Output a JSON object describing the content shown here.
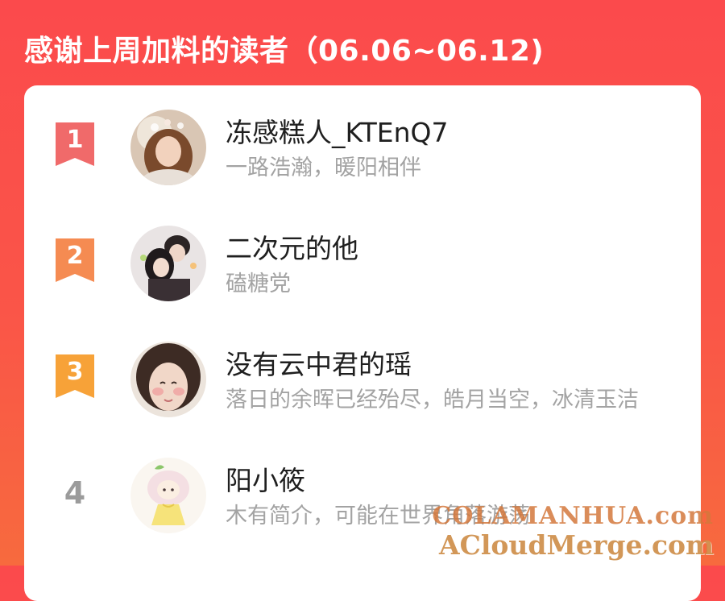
{
  "header": {
    "title": "感谢上周加料的读者（06.06~06.12)"
  },
  "readers": [
    {
      "rank": "1",
      "name": "冻感糕人_KTEnQ7",
      "bio": "一路浩瀚，暖阳相伴",
      "badge_color": "#f06a6a"
    },
    {
      "rank": "2",
      "name": "二次元的他",
      "bio": "磕糖党",
      "badge_color": "#f58b52"
    },
    {
      "rank": "3",
      "name": "没有云中君的瑶",
      "bio": "落日的余晖已经殆尽，皓月当空，冰清玉洁",
      "badge_color": "#f7a238"
    },
    {
      "rank": "4",
      "name": "阳小筱",
      "bio": "木有简介，可能在世界角落游荡"
    }
  ],
  "watermark": {
    "line1": "COLAMANHUA.com",
    "line2": "ACloudMerge.com"
  },
  "colors": {
    "background_top": "#fb4a4c",
    "background_bottom": "#f76a3e",
    "rank_plain": "#9b9b9b"
  }
}
